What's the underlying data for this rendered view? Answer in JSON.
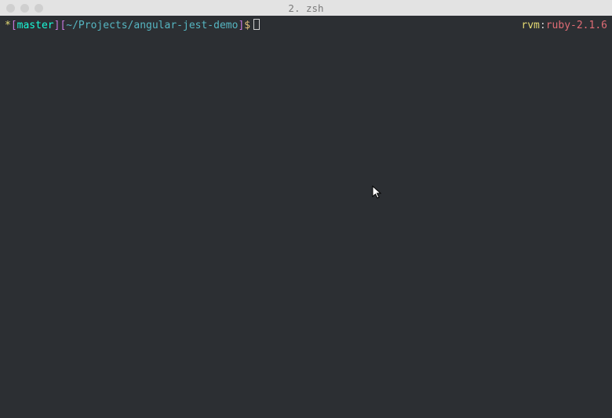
{
  "titlebar": {
    "title": "2. zsh"
  },
  "prompt": {
    "asterisk": "*",
    "bracket_open": "[",
    "branch": "master",
    "bracket_close": "]",
    "bracket_open2": "[",
    "path": "~/Projects/angular-jest-demo",
    "bracket_close2": "]",
    "dollar": "$"
  },
  "rvm": {
    "label": "rvm",
    "colon": ":",
    "version": "ruby-2.1.6"
  }
}
